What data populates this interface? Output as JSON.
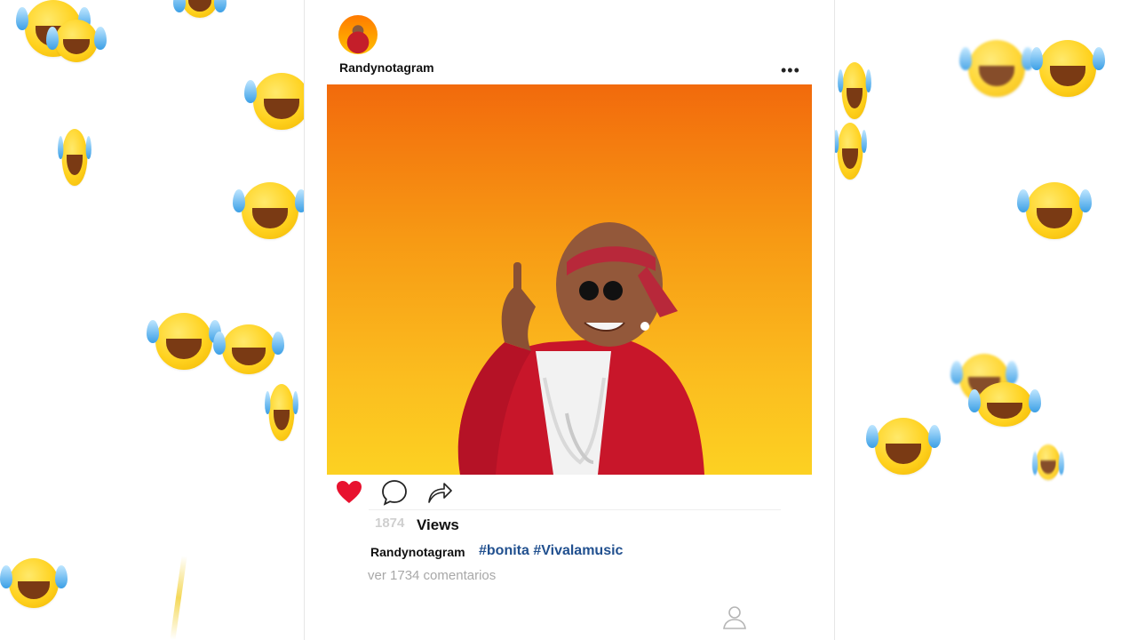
{
  "post": {
    "username": "Randynotagram",
    "more_icon": "•••",
    "views_count": "1874",
    "views_label": "Views",
    "caption_username": "Randynotagram",
    "hashtags": "#bonita #Vivalamusic",
    "comments_link": "ver 1734 comentarios"
  },
  "icons": {
    "like": "heart-icon",
    "comment": "comment-bubble-icon",
    "share": "share-arrow-icon",
    "profile": "profile-icon"
  },
  "colors": {
    "like": "#e8122f",
    "hashtag": "#21508f",
    "photo_top": "#f26a0c",
    "photo_bottom": "#fcd122",
    "emoji": "#ffd21f"
  }
}
